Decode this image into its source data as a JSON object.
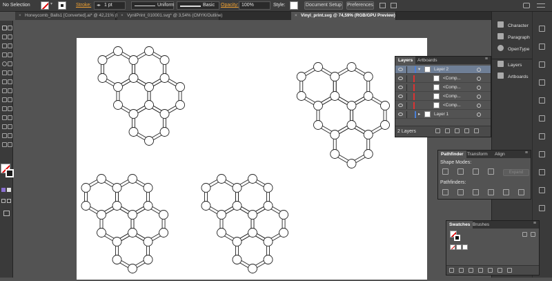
{
  "control_bar": {
    "selection_label": "No Selection",
    "stroke_label": "Stroke:",
    "stroke_weight": "1 pt",
    "stroke_profile": "Uniform",
    "brush_style": "Basic",
    "opacity_label": "Opacity:",
    "opacity_value": "100%",
    "style_label": "Style:",
    "document_setup": "Document Setup",
    "preferences": "Preferences"
  },
  "tabs": [
    {
      "title": "Honeycomb_Balls1 [Converted].ai* @ 42,21% (RGB/GPU Preview)",
      "active": false
    },
    {
      "title": "VynilPrint_010001.svg* @ 3,54% (CMYK/Outline)",
      "active": false
    },
    {
      "title": "Vinyl_print.svg @ 74,59% (RGB/GPU Preview)",
      "active": true
    }
  ],
  "dock": {
    "items": [
      "Character",
      "Paragraph",
      "OpenType",
      "Layers",
      "Artboards"
    ]
  },
  "layers_panel": {
    "tabs": [
      "Layers",
      "Artboards"
    ],
    "rows": [
      {
        "name": "Layer 2",
        "level": 0,
        "selected": true,
        "color": "#4a7fd6"
      },
      {
        "name": "<Comp...",
        "level": 1,
        "selected": false,
        "color": "#d33"
      },
      {
        "name": "<Comp...",
        "level": 1,
        "selected": false,
        "color": "#d33"
      },
      {
        "name": "<Comp...",
        "level": 1,
        "selected": false,
        "color": "#d33"
      },
      {
        "name": "<Comp...",
        "level": 1,
        "selected": false,
        "color": "#d33"
      },
      {
        "name": "Layer 1",
        "level": 0,
        "selected": false,
        "color": "#4a7fd6"
      }
    ],
    "footer": "2 Layers"
  },
  "pathfinder_panel": {
    "tabs": [
      "Pathfinder",
      "Transform",
      "Align"
    ],
    "shape_modes_label": "Shape Modes:",
    "expand_label": "Expand",
    "pathfinders_label": "Pathfinders:"
  },
  "swatches_panel": {
    "tabs": [
      "Swatches",
      "Brushes"
    ]
  }
}
